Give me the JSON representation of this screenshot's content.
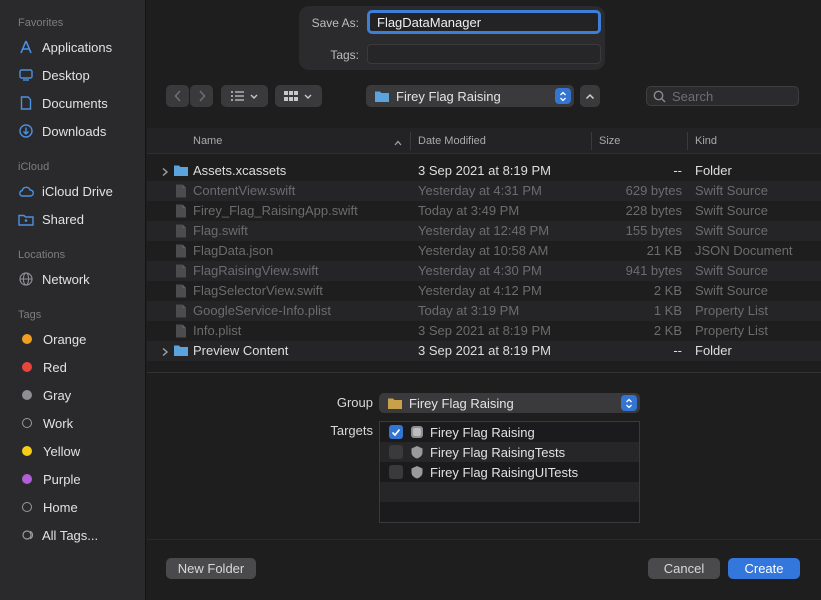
{
  "sidebar": {
    "favorites_label": "Favorites",
    "favorites": [
      {
        "label": "Applications",
        "icon": "applications-icon"
      },
      {
        "label": "Desktop",
        "icon": "desktop-icon"
      },
      {
        "label": "Documents",
        "icon": "documents-icon"
      },
      {
        "label": "Downloads",
        "icon": "downloads-icon"
      }
    ],
    "icloud_label": "iCloud",
    "icloud": [
      {
        "label": "iCloud Drive",
        "icon": "cloud-icon"
      },
      {
        "label": "Shared",
        "icon": "shared-folder-icon"
      }
    ],
    "locations_label": "Locations",
    "locations": [
      {
        "label": "Network",
        "icon": "globe-icon"
      }
    ],
    "tags_label": "Tags",
    "tags": [
      {
        "label": "Orange",
        "color": "#f0a020"
      },
      {
        "label": "Red",
        "color": "#e8453c"
      },
      {
        "label": "Gray",
        "color": "#8e8e93"
      },
      {
        "label": "Work",
        "color": ""
      },
      {
        "label": "Yellow",
        "color": "#f5cc1a"
      },
      {
        "label": "Purple",
        "color": "#b15fd6"
      },
      {
        "label": "Home",
        "color": ""
      },
      {
        "label": "All Tags...",
        "color": ""
      }
    ]
  },
  "save_as": {
    "label": "Save As:",
    "value": "FlagDataManager"
  },
  "tags_field": {
    "label": "Tags:",
    "value": ""
  },
  "location": {
    "value": "Firey Flag Raising"
  },
  "search": {
    "placeholder": "Search"
  },
  "table": {
    "headers": {
      "name": "Name",
      "date": "Date Modified",
      "size": "Size",
      "kind": "Kind"
    },
    "rows": [
      {
        "name": "Assets.xcassets",
        "date": "3 Sep 2021 at 8:19 PM",
        "size": "--",
        "kind": "Folder",
        "type": "folder"
      },
      {
        "name": "ContentView.swift",
        "date": "Yesterday at 4:31 PM",
        "size": "629 bytes",
        "kind": "Swift Source",
        "type": "file"
      },
      {
        "name": "Firey_Flag_RaisingApp.swift",
        "date": "Today at 3:49 PM",
        "size": "228 bytes",
        "kind": "Swift Source",
        "type": "file"
      },
      {
        "name": "Flag.swift",
        "date": "Yesterday at 12:48 PM",
        "size": "155 bytes",
        "kind": "Swift Source",
        "type": "file"
      },
      {
        "name": "FlagData.json",
        "date": "Yesterday at 10:58 AM",
        "size": "21 KB",
        "kind": "JSON Document",
        "type": "file"
      },
      {
        "name": "FlagRaisingView.swift",
        "date": "Yesterday at 4:30 PM",
        "size": "941 bytes",
        "kind": "Swift Source",
        "type": "file"
      },
      {
        "name": "FlagSelectorView.swift",
        "date": "Yesterday at 4:12 PM",
        "size": "2 KB",
        "kind": "Swift Source",
        "type": "file"
      },
      {
        "name": "GoogleService-Info.plist",
        "date": "Today at 3:19 PM",
        "size": "1 KB",
        "kind": "Property List",
        "type": "file"
      },
      {
        "name": "Info.plist",
        "date": "3 Sep 2021 at 8:19 PM",
        "size": "2 KB",
        "kind": "Property List",
        "type": "file"
      },
      {
        "name": "Preview Content",
        "date": "3 Sep 2021 at 8:19 PM",
        "size": "--",
        "kind": "Folder",
        "type": "folder"
      }
    ]
  },
  "group": {
    "label": "Group",
    "value": "Firey Flag Raising"
  },
  "targets": {
    "label": "Targets",
    "items": [
      {
        "label": "Firey Flag Raising",
        "checked": true,
        "icon": "app-target-icon"
      },
      {
        "label": "Firey Flag RaisingTests",
        "checked": false,
        "icon": "test-target-icon"
      },
      {
        "label": "Firey Flag RaisingUITests",
        "checked": false,
        "icon": "test-target-icon"
      }
    ]
  },
  "buttons": {
    "new_folder": "New Folder",
    "cancel": "Cancel",
    "create": "Create"
  },
  "colors": {
    "accent": "#3477dc",
    "background": "#1e1e1e",
    "sidebar": "#2a2a2c"
  }
}
